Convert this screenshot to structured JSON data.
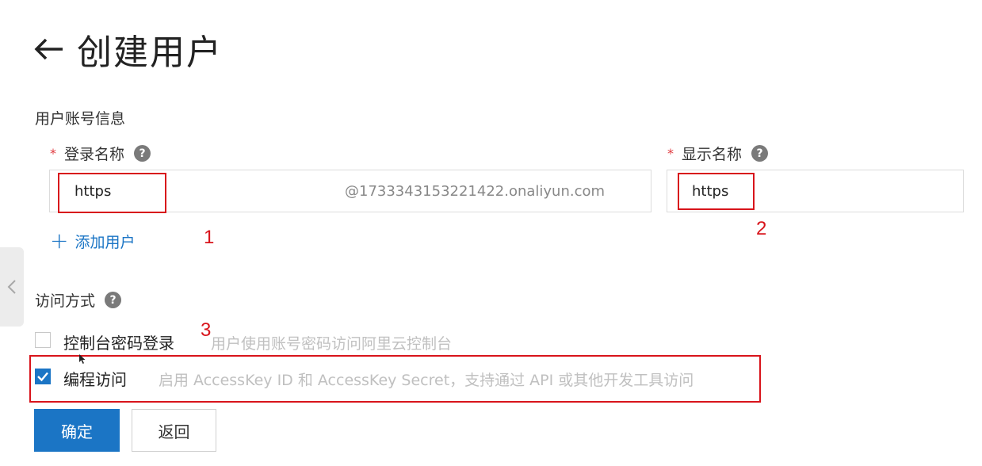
{
  "header": {
    "back_icon": "arrow-left-icon",
    "title": "创建用户"
  },
  "account_section": {
    "title": "用户账号信息",
    "login_name": {
      "required_mark": "*",
      "label": "登录名称",
      "value": "https",
      "suffix": "@1733343153221422.onaliyun.com"
    },
    "display_name": {
      "required_mark": "*",
      "label": "显示名称",
      "value": "https"
    },
    "help_icon_glyph": "?",
    "add_user_plus": "+",
    "add_user_label": "添加用户"
  },
  "access_section": {
    "title": "访问方式",
    "options": [
      {
        "label": "控制台密码登录",
        "description": "用户使用账号密码访问阿里云控制台",
        "checked": false
      },
      {
        "label": "编程访问",
        "description": "启用 AccessKey ID 和 AccessKey Secret，支持通过 API 或其他开发工具访问",
        "checked": true
      }
    ]
  },
  "annotations": {
    "one": "1",
    "two": "2",
    "three": "3"
  },
  "buttons": {
    "confirm": "确定",
    "back": "返回"
  },
  "colors": {
    "primary": "#1b75c5",
    "required": "#e0393e",
    "annotation": "#d8141b"
  }
}
